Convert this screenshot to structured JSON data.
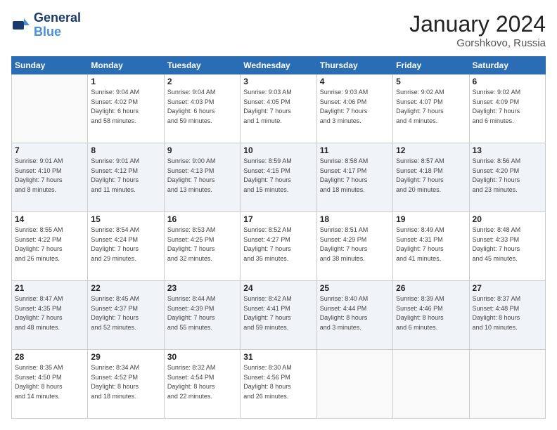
{
  "header": {
    "logo_line1": "General",
    "logo_line2": "Blue",
    "month": "January 2024",
    "location": "Gorshkovo, Russia"
  },
  "weekdays": [
    "Sunday",
    "Monday",
    "Tuesday",
    "Wednesday",
    "Thursday",
    "Friday",
    "Saturday"
  ],
  "weeks": [
    [
      {
        "day": "",
        "info": ""
      },
      {
        "day": "1",
        "info": "Sunrise: 9:04 AM\nSunset: 4:02 PM\nDaylight: 6 hours\nand 58 minutes."
      },
      {
        "day": "2",
        "info": "Sunrise: 9:04 AM\nSunset: 4:03 PM\nDaylight: 6 hours\nand 59 minutes."
      },
      {
        "day": "3",
        "info": "Sunrise: 9:03 AM\nSunset: 4:05 PM\nDaylight: 7 hours\nand 1 minute."
      },
      {
        "day": "4",
        "info": "Sunrise: 9:03 AM\nSunset: 4:06 PM\nDaylight: 7 hours\nand 3 minutes."
      },
      {
        "day": "5",
        "info": "Sunrise: 9:02 AM\nSunset: 4:07 PM\nDaylight: 7 hours\nand 4 minutes."
      },
      {
        "day": "6",
        "info": "Sunrise: 9:02 AM\nSunset: 4:09 PM\nDaylight: 7 hours\nand 6 minutes."
      }
    ],
    [
      {
        "day": "7",
        "info": "Sunrise: 9:01 AM\nSunset: 4:10 PM\nDaylight: 7 hours\nand 8 minutes."
      },
      {
        "day": "8",
        "info": "Sunrise: 9:01 AM\nSunset: 4:12 PM\nDaylight: 7 hours\nand 11 minutes."
      },
      {
        "day": "9",
        "info": "Sunrise: 9:00 AM\nSunset: 4:13 PM\nDaylight: 7 hours\nand 13 minutes."
      },
      {
        "day": "10",
        "info": "Sunrise: 8:59 AM\nSunset: 4:15 PM\nDaylight: 7 hours\nand 15 minutes."
      },
      {
        "day": "11",
        "info": "Sunrise: 8:58 AM\nSunset: 4:17 PM\nDaylight: 7 hours\nand 18 minutes."
      },
      {
        "day": "12",
        "info": "Sunrise: 8:57 AM\nSunset: 4:18 PM\nDaylight: 7 hours\nand 20 minutes."
      },
      {
        "day": "13",
        "info": "Sunrise: 8:56 AM\nSunset: 4:20 PM\nDaylight: 7 hours\nand 23 minutes."
      }
    ],
    [
      {
        "day": "14",
        "info": "Sunrise: 8:55 AM\nSunset: 4:22 PM\nDaylight: 7 hours\nand 26 minutes."
      },
      {
        "day": "15",
        "info": "Sunrise: 8:54 AM\nSunset: 4:24 PM\nDaylight: 7 hours\nand 29 minutes."
      },
      {
        "day": "16",
        "info": "Sunrise: 8:53 AM\nSunset: 4:25 PM\nDaylight: 7 hours\nand 32 minutes."
      },
      {
        "day": "17",
        "info": "Sunrise: 8:52 AM\nSunset: 4:27 PM\nDaylight: 7 hours\nand 35 minutes."
      },
      {
        "day": "18",
        "info": "Sunrise: 8:51 AM\nSunset: 4:29 PM\nDaylight: 7 hours\nand 38 minutes."
      },
      {
        "day": "19",
        "info": "Sunrise: 8:49 AM\nSunset: 4:31 PM\nDaylight: 7 hours\nand 41 minutes."
      },
      {
        "day": "20",
        "info": "Sunrise: 8:48 AM\nSunset: 4:33 PM\nDaylight: 7 hours\nand 45 minutes."
      }
    ],
    [
      {
        "day": "21",
        "info": "Sunrise: 8:47 AM\nSunset: 4:35 PM\nDaylight: 7 hours\nand 48 minutes."
      },
      {
        "day": "22",
        "info": "Sunrise: 8:45 AM\nSunset: 4:37 PM\nDaylight: 7 hours\nand 52 minutes."
      },
      {
        "day": "23",
        "info": "Sunrise: 8:44 AM\nSunset: 4:39 PM\nDaylight: 7 hours\nand 55 minutes."
      },
      {
        "day": "24",
        "info": "Sunrise: 8:42 AM\nSunset: 4:41 PM\nDaylight: 7 hours\nand 59 minutes."
      },
      {
        "day": "25",
        "info": "Sunrise: 8:40 AM\nSunset: 4:44 PM\nDaylight: 8 hours\nand 3 minutes."
      },
      {
        "day": "26",
        "info": "Sunrise: 8:39 AM\nSunset: 4:46 PM\nDaylight: 8 hours\nand 6 minutes."
      },
      {
        "day": "27",
        "info": "Sunrise: 8:37 AM\nSunset: 4:48 PM\nDaylight: 8 hours\nand 10 minutes."
      }
    ],
    [
      {
        "day": "28",
        "info": "Sunrise: 8:35 AM\nSunset: 4:50 PM\nDaylight: 8 hours\nand 14 minutes."
      },
      {
        "day": "29",
        "info": "Sunrise: 8:34 AM\nSunset: 4:52 PM\nDaylight: 8 hours\nand 18 minutes."
      },
      {
        "day": "30",
        "info": "Sunrise: 8:32 AM\nSunset: 4:54 PM\nDaylight: 8 hours\nand 22 minutes."
      },
      {
        "day": "31",
        "info": "Sunrise: 8:30 AM\nSunset: 4:56 PM\nDaylight: 8 hours\nand 26 minutes."
      },
      {
        "day": "",
        "info": ""
      },
      {
        "day": "",
        "info": ""
      },
      {
        "day": "",
        "info": ""
      }
    ]
  ]
}
